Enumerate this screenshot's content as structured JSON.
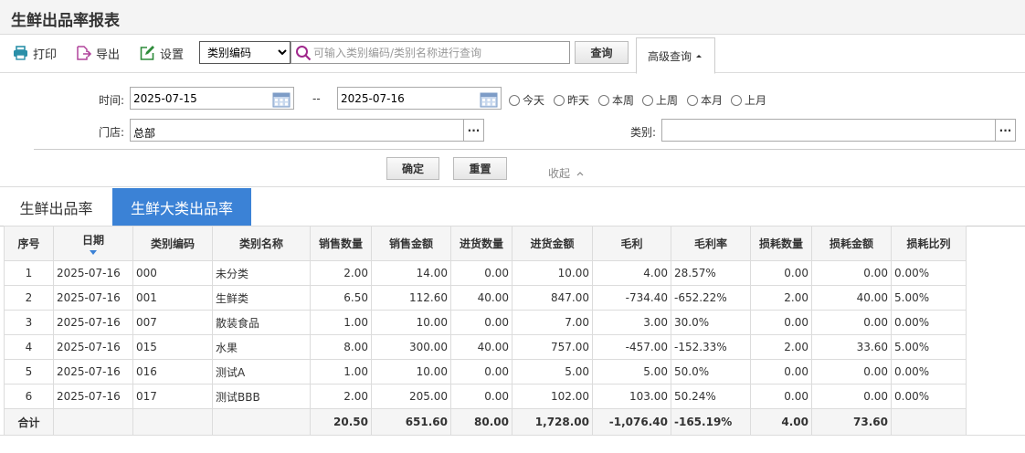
{
  "page_title": "生鲜出品率报表",
  "toolbar": {
    "print_label": "打印",
    "export_label": "导出",
    "settings_label": "设置",
    "search_field_value": "类别编码",
    "search_placeholder": "可输入类别编码/类别名称进行查询",
    "query_label": "查询",
    "advanced_label": "高级查询"
  },
  "filters": {
    "time_label": "时间:",
    "date_from": "2025-07-15",
    "date_sep": "--",
    "date_to": "2025-07-16",
    "quick_ranges": [
      "今天",
      "昨天",
      "本周",
      "上周",
      "本月",
      "上月"
    ],
    "store_label": "门店:",
    "store_value": "总部",
    "category_label": "类别:",
    "category_value": "",
    "confirm_label": "确定",
    "reset_label": "重置",
    "collapse_label": "收起"
  },
  "tabs": [
    {
      "label": "生鲜出品率",
      "active": false
    },
    {
      "label": "生鲜大类出品率",
      "active": true
    }
  ],
  "table": {
    "headers": [
      "序号",
      "日期",
      "类别编码",
      "类别名称",
      "销售数量",
      "销售金额",
      "进货数量",
      "进货金额",
      "毛利",
      "毛利率",
      "损耗数量",
      "损耗金额",
      "损耗比列"
    ],
    "rows": [
      [
        "1",
        "2025-07-16",
        "000",
        "未分类",
        "2.00",
        "14.00",
        "0.00",
        "10.00",
        "4.00",
        "28.57%",
        "0.00",
        "0.00",
        "0.00%"
      ],
      [
        "2",
        "2025-07-16",
        "001",
        "生鲜类",
        "6.50",
        "112.60",
        "40.00",
        "847.00",
        "-734.40",
        "-652.22%",
        "2.00",
        "40.00",
        "5.00%"
      ],
      [
        "3",
        "2025-07-16",
        "007",
        "散装食品",
        "1.00",
        "10.00",
        "0.00",
        "7.00",
        "3.00",
        "30.0%",
        "0.00",
        "0.00",
        "0.00%"
      ],
      [
        "4",
        "2025-07-16",
        "015",
        "水果",
        "8.00",
        "300.00",
        "40.00",
        "757.00",
        "-457.00",
        "-152.33%",
        "2.00",
        "33.60",
        "5.00%"
      ],
      [
        "5",
        "2025-07-16",
        "016",
        "测试A",
        "1.00",
        "10.00",
        "0.00",
        "5.00",
        "5.00",
        "50.0%",
        "0.00",
        "0.00",
        "0.00%"
      ],
      [
        "6",
        "2025-07-16",
        "017",
        "测试BBB",
        "2.00",
        "205.00",
        "0.00",
        "102.00",
        "103.00",
        "50.24%",
        "0.00",
        "0.00",
        "0.00%"
      ]
    ],
    "total": [
      "合计",
      "",
      "",
      "",
      "20.50",
      "651.60",
      "80.00",
      "1,728.00",
      "-1,076.40",
      "-165.19%",
      "4.00",
      "73.60",
      ""
    ]
  },
  "colors": {
    "accent": "#3b82d6",
    "print_icon": "#2a8fa8",
    "export_icon": "#b1449c",
    "settings_icon": "#2e8b3a",
    "search_icon": "#a0288c"
  }
}
